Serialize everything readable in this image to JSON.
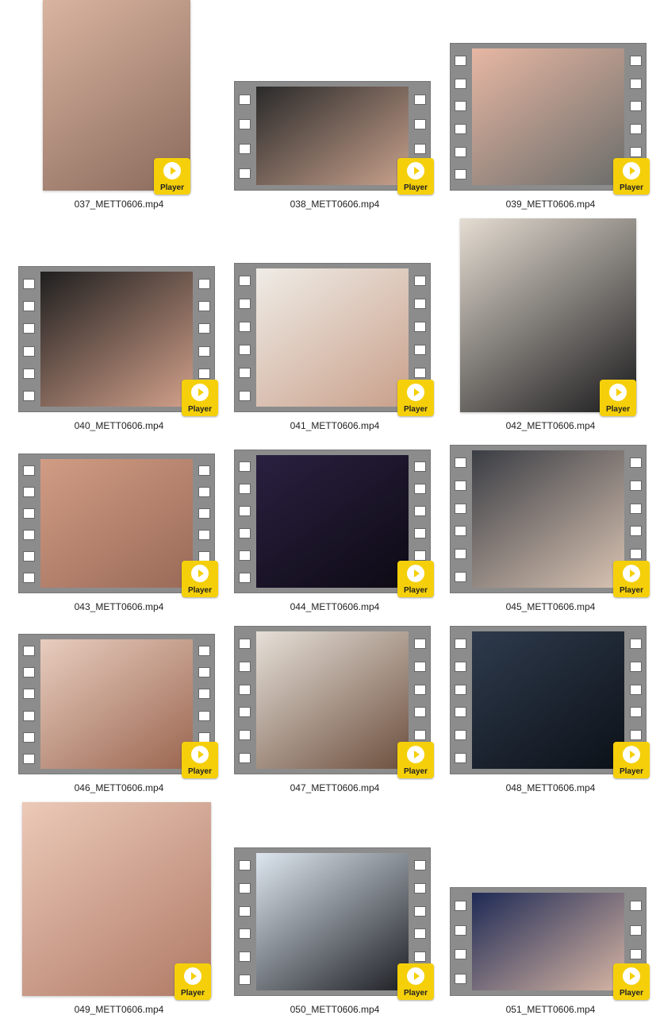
{
  "player_label": "Player",
  "files": [
    {
      "name": "037_METT0606.mp4",
      "style": "plain",
      "bg": [
        "#d9b4a0",
        "#8a6a5c"
      ]
    },
    {
      "name": "038_METT0606.mp4",
      "style": "film",
      "bg": [
        "#2a2a2a",
        "#c8a18c"
      ]
    },
    {
      "name": "039_METT0606.mp4",
      "style": "film",
      "bg": [
        "#e7b7a3",
        "#6b6d6a"
      ]
    },
    {
      "name": "040_METT0606.mp4",
      "style": "film",
      "bg": [
        "#1f1f1f",
        "#d2a08a"
      ]
    },
    {
      "name": "041_METT0606.mp4",
      "style": "film",
      "bg": [
        "#efece6",
        "#c9a08b"
      ]
    },
    {
      "name": "042_METT0606.mp4",
      "style": "plain",
      "bg": [
        "#e5ddd2",
        "#1a1a1c"
      ]
    },
    {
      "name": "043_METT0606.mp4",
      "style": "film",
      "bg": [
        "#d19c84",
        "#9a6a58"
      ]
    },
    {
      "name": "044_METT0606.mp4",
      "style": "film",
      "bg": [
        "#2a2040",
        "#0d0a14"
      ]
    },
    {
      "name": "045_METT0606.mp4",
      "style": "film",
      "bg": [
        "#3a3d44",
        "#d9c3b2"
      ]
    },
    {
      "name": "046_METT0606.mp4",
      "style": "film",
      "bg": [
        "#e8cdbf",
        "#9b6650"
      ]
    },
    {
      "name": "047_METT0606.mp4",
      "style": "film",
      "bg": [
        "#e6e0d8",
        "#6d4f3e"
      ]
    },
    {
      "name": "048_METT0606.mp4",
      "style": "film",
      "bg": [
        "#2e3a4c",
        "#0c1118"
      ]
    },
    {
      "name": "049_METT0606.mp4",
      "style": "plain",
      "bg": [
        "#ecc9b8",
        "#b07a66"
      ]
    },
    {
      "name": "050_METT0606.mp4",
      "style": "film",
      "bg": [
        "#dde6ef",
        "#1d1f24"
      ]
    },
    {
      "name": "051_METT0606.mp4",
      "style": "film",
      "bg": [
        "#1e2a55",
        "#d7b5a3"
      ]
    }
  ]
}
